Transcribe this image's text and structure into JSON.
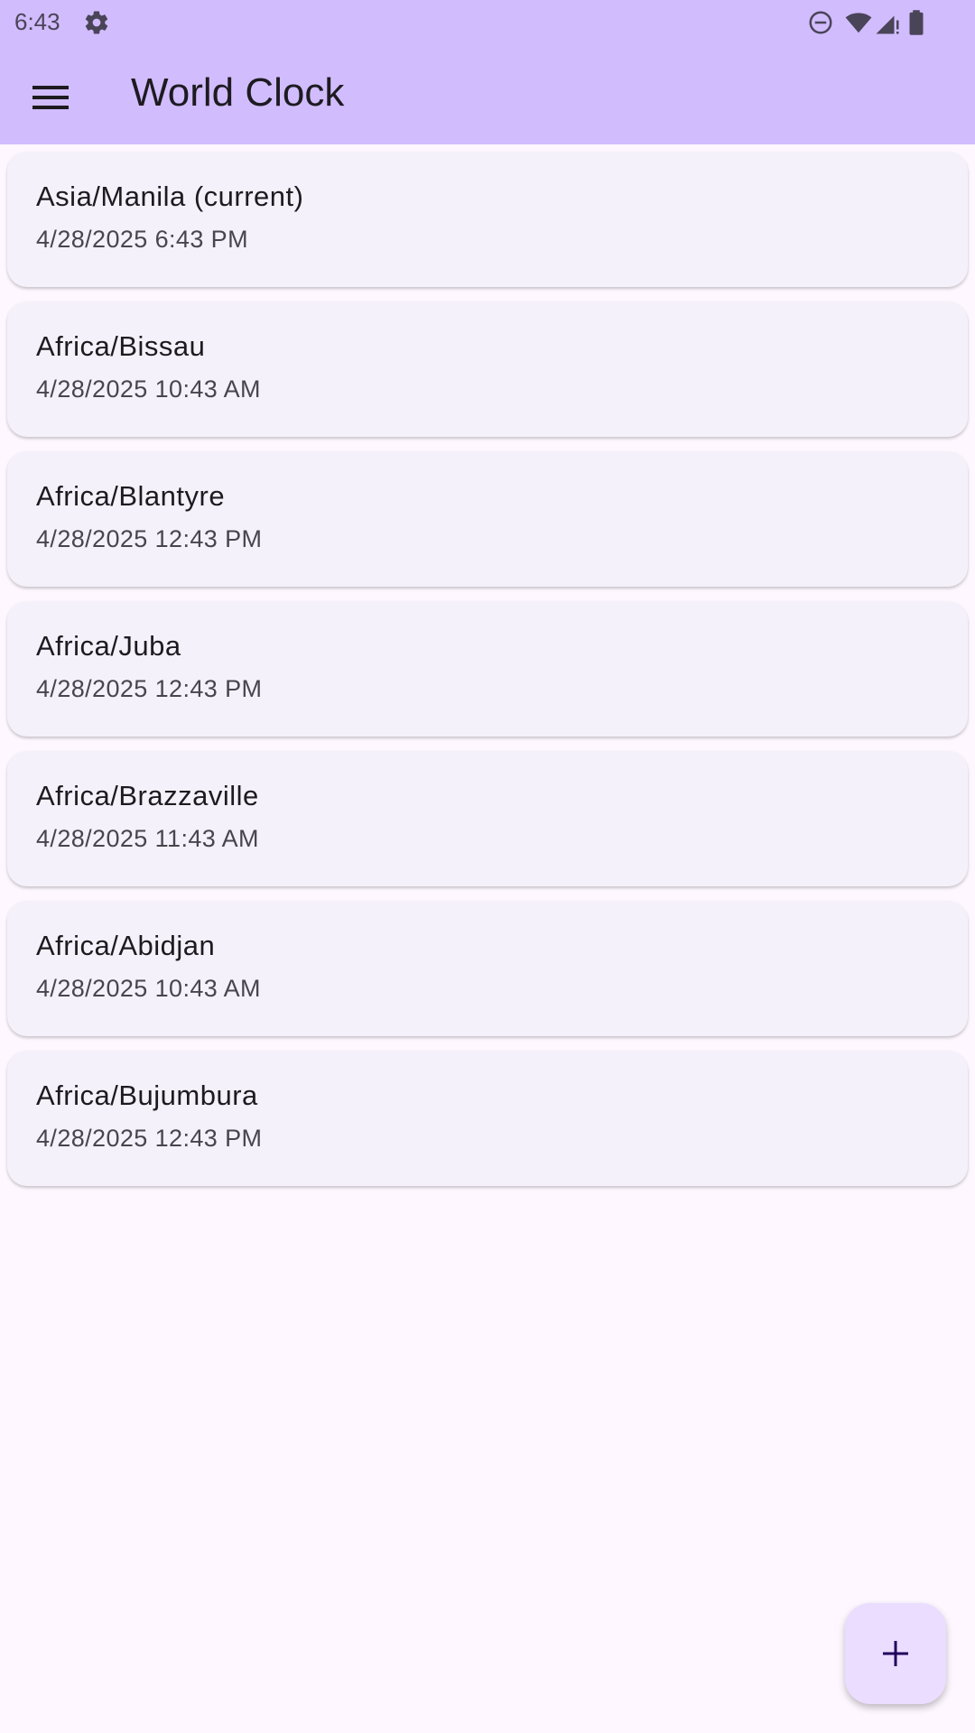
{
  "status_bar": {
    "time": "6:43",
    "icons": [
      "gear-icon",
      "do-not-disturb-icon",
      "wifi-icon",
      "signal-icon",
      "battery-icon"
    ]
  },
  "app_bar": {
    "title": "World Clock",
    "menu_icon": "hamburger-menu-icon",
    "background_color": "#d1bcfe"
  },
  "clocks": [
    {
      "zone": "Asia/Manila (current)",
      "time": "4/28/2025 6:43 PM"
    },
    {
      "zone": "Africa/Bissau",
      "time": "4/28/2025 10:43 AM"
    },
    {
      "zone": "Africa/Blantyre",
      "time": "4/28/2025 12:43 PM"
    },
    {
      "zone": "Africa/Juba",
      "time": "4/28/2025 12:43 PM"
    },
    {
      "zone": "Africa/Brazzaville",
      "time": "4/28/2025 11:43 AM"
    },
    {
      "zone": "Africa/Abidjan",
      "time": "4/28/2025 10:43 AM"
    },
    {
      "zone": "Africa/Bujumbura",
      "time": "4/28/2025 12:43 PM"
    }
  ],
  "fab": {
    "icon": "plus-icon",
    "color": "#eaddff"
  }
}
